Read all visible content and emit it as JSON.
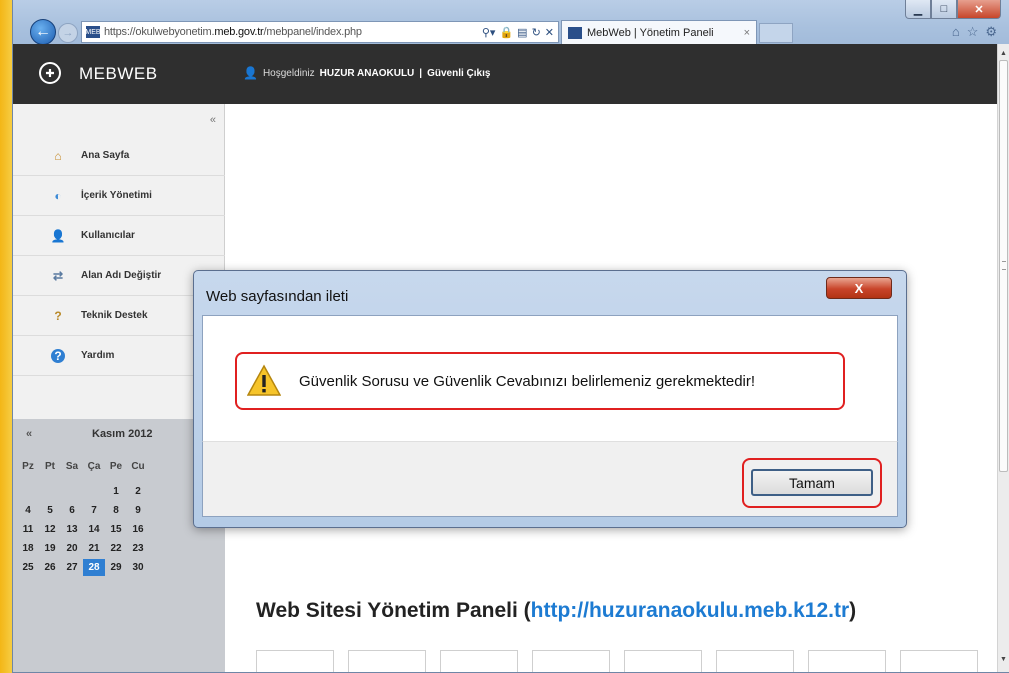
{
  "browser": {
    "address_scheme": "https://",
    "address_host_prefix": "okulwebyonetim.",
    "address_host_main": "meb.gov.tr",
    "address_path": "/mebpanel/index.php",
    "tab_title": "MebWeb | Yönetim Paneli",
    "tab_close": "×"
  },
  "site": {
    "name": "MEBWEB",
    "welcome": "Hoşgeldiniz",
    "user": "HUZUR ANAOKULU",
    "separator": "|",
    "logout": "Güvenli Çıkış",
    "collapse": "«"
  },
  "sidebar": {
    "items": [
      {
        "label": "Ana Sayfa",
        "icon": "home-icon"
      },
      {
        "label": "İçerik Yönetimi",
        "icon": "content-icon"
      },
      {
        "label": "Kullanıcılar",
        "icon": "users-icon"
      },
      {
        "label": "Alan Adı Değiştir",
        "icon": "domain-icon"
      },
      {
        "label": "Teknik Destek",
        "icon": "support-icon"
      },
      {
        "label": "Yardım",
        "icon": "help-icon"
      }
    ]
  },
  "calendar": {
    "prev": "«",
    "title": "Kasım 2012",
    "days": [
      "Pz",
      "Pt",
      "Sa",
      "Ça",
      "Pe",
      "Cu"
    ],
    "rows": [
      [
        "",
        "",
        "",
        "",
        "1",
        "2"
      ],
      [
        "4",
        "5",
        "6",
        "7",
        "8",
        "9"
      ],
      [
        "11",
        "12",
        "13",
        "14",
        "15",
        "16"
      ],
      [
        "18",
        "19",
        "20",
        "21",
        "22",
        "23"
      ],
      [
        "25",
        "26",
        "27",
        "28",
        "29",
        "30"
      ]
    ],
    "today": "28"
  },
  "page": {
    "title_prefix": "Web Sitesi Yönetim Paneli (",
    "title_link": "http://huzuranaokulu.meb.k12.tr",
    "title_suffix": ")"
  },
  "dialog": {
    "title": "Web sayfasından ileti",
    "message": "Güvenlik Sorusu ve Güvenlik Cevabınızı belirlemeniz gerekmektedir!",
    "ok_label": "Tamam",
    "close_label": "X"
  },
  "colors": {
    "accent_red": "#e02020",
    "link_blue": "#1d7bd2",
    "header_dark": "#2f2f2f",
    "today_blue": "#2f7fd2"
  }
}
